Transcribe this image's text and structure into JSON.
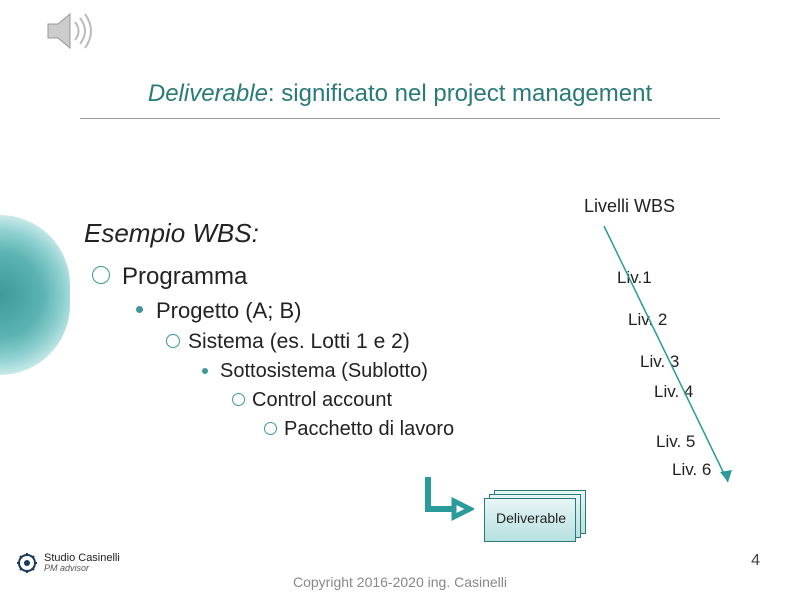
{
  "title_italic": "Deliverable",
  "title_rest": ": significato nel project management",
  "heading": "Esempio WBS:",
  "wbs": {
    "l1": "Programma",
    "l2": "Progetto (A; B)",
    "l3": "Sistema (es. Lotti 1 e 2)",
    "l4": "Sottosistema (Sublotto)",
    "l5": "Control account",
    "l6": "Pacchetto di lavoro"
  },
  "levels_label": "Livelli WBS",
  "levels": {
    "l1": "Liv.1",
    "l2": "Liv. 2",
    "l3": "Liv. 3",
    "l4": "Liv. 4",
    "l5": "Liv. 5",
    "l6": "Liv. 6"
  },
  "deliverable_label": "Deliverable",
  "logo": {
    "name": "Studio Casinelli",
    "sub": "PM advisor"
  },
  "copyright": "Copyright 2016-2020 ing. Casinelli",
  "page": "4"
}
